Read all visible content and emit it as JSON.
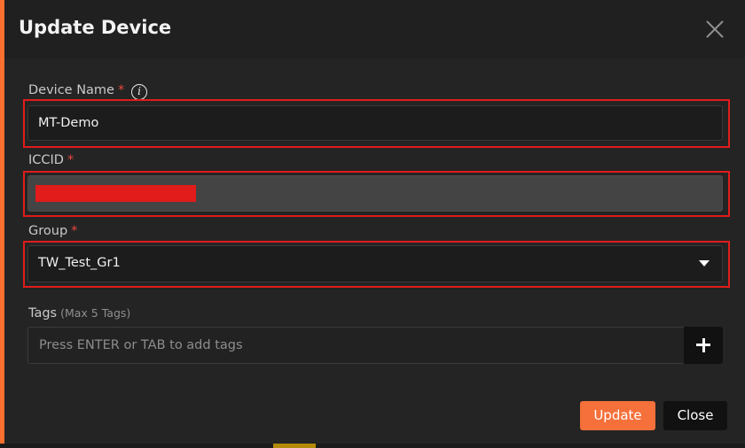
{
  "dialog": {
    "title": "Update Device"
  },
  "fields": {
    "device_name": {
      "label": "Device Name",
      "required_mark": "*",
      "value": "MT-Demo"
    },
    "iccid": {
      "label": "ICCID",
      "required_mark": "*",
      "value_redacted": true
    },
    "group": {
      "label": "Group",
      "required_mark": "*",
      "selected": "TW_Test_Gr1"
    },
    "tags": {
      "label": "Tags",
      "hint": "(Max 5 Tags)",
      "placeholder": "Press ENTER or TAB to add tags"
    }
  },
  "footer": {
    "update_label": "Update",
    "close_label": "Close"
  },
  "colors": {
    "accent": "#f5703a",
    "highlight": "#e01c1c",
    "required": "#e7473d",
    "redaction": "#e21b1b"
  },
  "icons": {
    "info": "info-icon",
    "close": "close-icon",
    "dropdown": "caret-down-icon",
    "add": "plus-icon"
  }
}
